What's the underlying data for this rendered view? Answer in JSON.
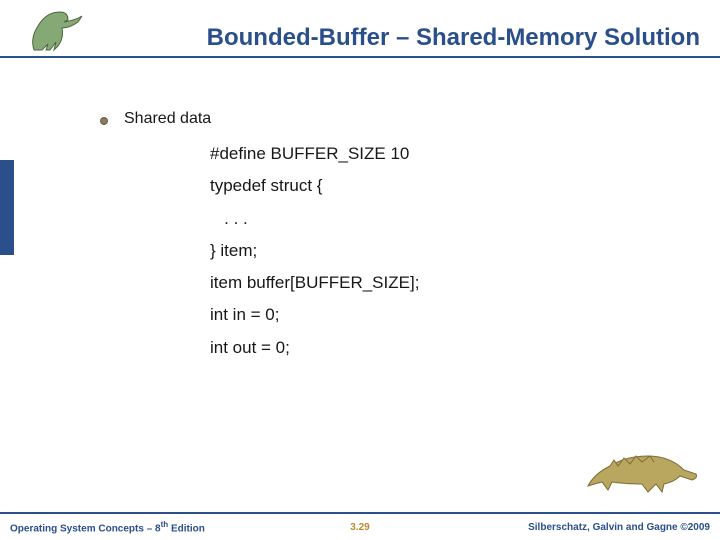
{
  "header": {
    "title": "Bounded-Buffer – Shared-Memory Solution"
  },
  "content": {
    "bullet_label": "Shared data",
    "code_lines": [
      "#define BUFFER_SIZE 10",
      "typedef struct {",
      "   . . .",
      "} item;",
      "",
      "item buffer[BUFFER_SIZE];",
      "int in = 0;",
      "int out = 0;"
    ]
  },
  "footer": {
    "left_prefix": "Operating System Concepts – 8",
    "left_suffix": " Edition",
    "left_sup": "th",
    "center": "3.29",
    "right": "Silberschatz, Galvin and Gagne ©2009"
  }
}
